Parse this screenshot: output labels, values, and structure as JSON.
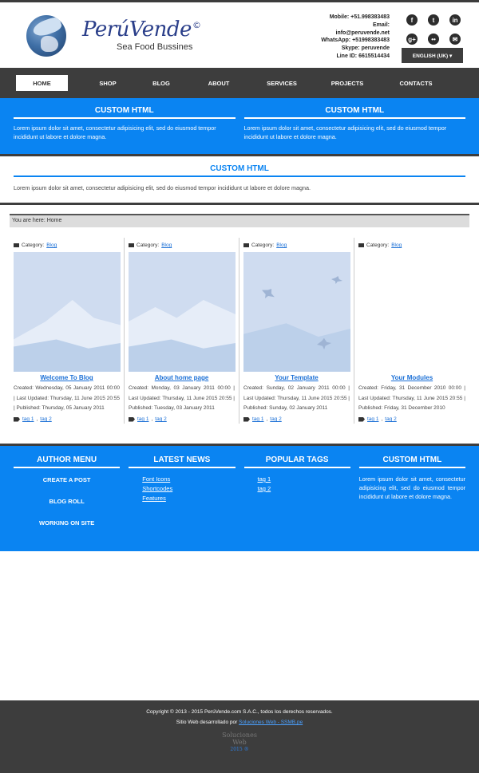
{
  "brand": {
    "name": "PerúVende",
    "reg": "©",
    "tagline": "Sea Food Bussines"
  },
  "contact": [
    "Mobile: +51.998383483",
    "Email:",
    "info@peruvende.net",
    "WhatsApp: +51998383483",
    "Skype: peruvende",
    "Line ID: 6615514434"
  ],
  "social": [
    {
      "icon": "facebook-icon",
      "glyph": "f"
    },
    {
      "icon": "tumblr-icon",
      "glyph": "t"
    },
    {
      "icon": "linkedin-icon",
      "glyph": "in"
    },
    {
      "icon": "google-plus-icon",
      "glyph": "g+"
    },
    {
      "icon": "flickr-icon",
      "glyph": "••"
    },
    {
      "icon": "mail-icon",
      "glyph": "✉"
    }
  ],
  "language": "ENGLISH (UK) ▾",
  "nav": [
    "HOME",
    "SHOP",
    "BLOG",
    "ABOUT",
    "SERVICES",
    "PROJECTS",
    "CONTACTS"
  ],
  "top_modules": [
    {
      "title": "CUSTOM HTML",
      "text": "Lorem ipsum dolor sit amet, consectetur adipisicing elit, sed do eiusmod tempor incididunt ut labore et dolore magna."
    },
    {
      "title": "CUSTOM HTML",
      "text": "Lorem ipsum dolor sit amet, consectetur adipisicing elit, sed do eiusmod tempor incididunt ut labore et dolore magna."
    }
  ],
  "wide_module": {
    "title": "CUSTOM HTML",
    "text": "Lorem ipsum dolor sit amet, consectetur adipisicing elit, sed do eiusmod tempor incididunt ut labore et dolore magna."
  },
  "breadcrumb": "You are here:  Home",
  "articles": [
    {
      "category_label": "Category:",
      "category": "Blog",
      "title": "Welcome To Blog",
      "meta": "Created: Wednesday, 05 January 2011 00:00 | Last Updated: Thursday, 11 June 2015 20:55 | Published: Thursday, 05 January 2011",
      "tags": [
        "tag 1",
        "tag 2"
      ]
    },
    {
      "category_label": "Category:",
      "category": "Blog",
      "title": "About home page",
      "meta": "Created: Monday, 03 January 2011 00:00 | Last Updated: Thursday, 11 June 2015 20:55 | Published: Tuesday, 03 January 2011",
      "tags": [
        "tag 1",
        "tag 2"
      ]
    },
    {
      "category_label": "Category:",
      "category": "Blog",
      "title": "Your Template",
      "meta": "Created: Sunday, 02 January 2011 00:00 | Last Updated: Thursday, 11 June 2015 20:55 | Published: Sunday, 02 January 2011",
      "tags": [
        "tag 1",
        "tag 2"
      ]
    },
    {
      "category_label": "Category:",
      "category": "Blog",
      "title": "Your Modules",
      "meta": "Created: Friday, 31 December 2010 00:00 | Last Updated: Thursday, 11 June 2015 20:55 | Published: Friday, 31 December 2010",
      "tags": [
        "tag 1",
        "tag 2"
      ]
    }
  ],
  "footer_cols": {
    "author": {
      "title": "AUTHOR MENU",
      "items": [
        "CREATE A POST",
        "BLOG ROLL",
        "WORKING ON SITE"
      ]
    },
    "news": {
      "title": "LATEST NEWS",
      "items": [
        "Font Icons",
        "Shortcodes",
        "Features"
      ]
    },
    "tags": {
      "title": "POPULAR TAGS",
      "items": [
        "tag 1",
        "tag 2"
      ]
    },
    "custom": {
      "title": "CUSTOM HTML",
      "text": "Lorem ipsum dolor sit amet, consectetur adipisicing elit, sed do eiusmod tempor incididunt ut labore et dolore magna."
    }
  },
  "copyright": "Copyright © 2013 - 2015 PerúVende.com S.A.C., todos los derechos reservados.",
  "credit_prefix": "Sitio Web desarrollado por",
  "credit_link": "Soluciones Web - SSMB.pe",
  "credit_logo": {
    "line1": "Soluciones",
    "line2": "Web",
    "year": "2015 ®"
  }
}
